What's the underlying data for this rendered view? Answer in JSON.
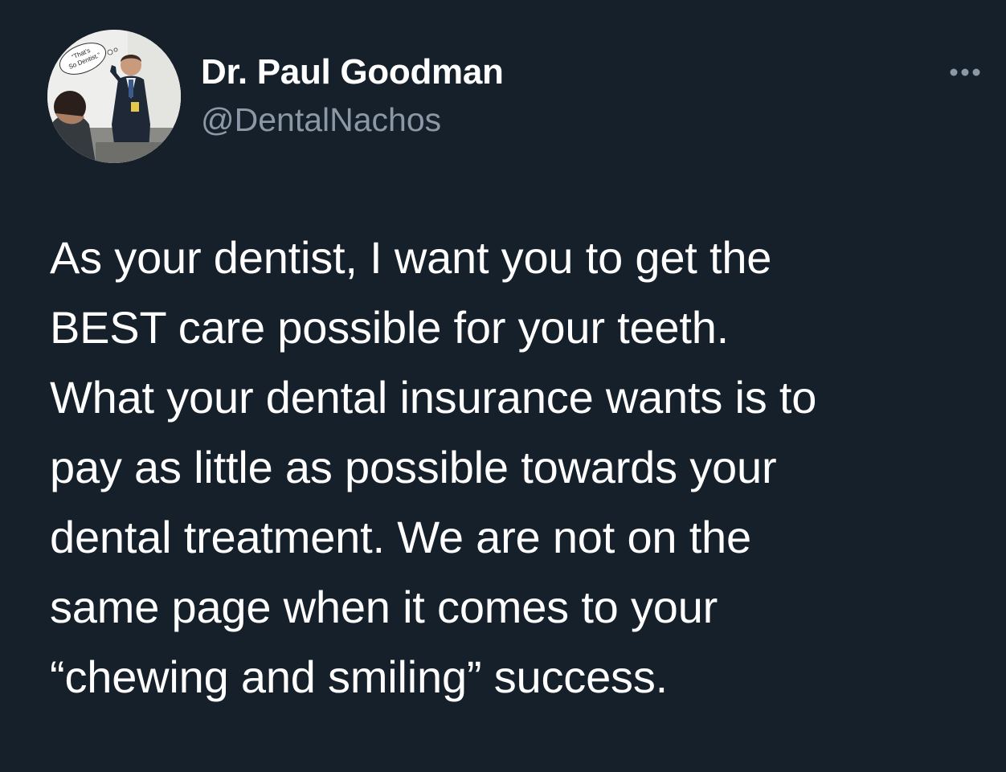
{
  "colors": {
    "background": "#15202b",
    "primary_text": "#ffffff",
    "secondary_text": "#8b98a5"
  },
  "author": {
    "display_name": "Dr. Paul Goodman",
    "handle": "@DentalNachos",
    "avatar_bubble_text": [
      "“That’s",
      "So Dentist.”"
    ]
  },
  "more_button": {
    "icon": "more-horizontal-icon"
  },
  "tweet": {
    "text": "As your dentist, I want you to get the\nBEST care possible for your teeth.\nWhat your dental insurance wants is to\npay as little as possible towards your\ndental treatment. We are not on the\nsame page when it comes to your\n“chewing and smiling” success."
  }
}
